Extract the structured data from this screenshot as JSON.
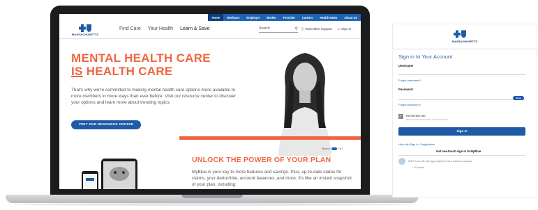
{
  "laptop": {
    "topbar": {
      "links": [
        {
          "label": "Home"
        },
        {
          "label": "Medicare"
        },
        {
          "label": "Employer"
        },
        {
          "label": "Broker"
        },
        {
          "label": "Provider"
        },
        {
          "label": "Careers"
        },
        {
          "label": "Health News"
        },
        {
          "label": "About Us"
        }
      ]
    },
    "nav": {
      "logo_text": "MASSACHUSETTS",
      "items": [
        "Find Care",
        "Your Health",
        "Learn & Save"
      ],
      "search_placeholder": "Search",
      "support_label": "Team Blue Support",
      "signin_label": "Sign In"
    },
    "hero": {
      "title_line1": "MENTAL HEALTH CARE",
      "title_is": "IS",
      "title_line2_rest": " HEALTH CARE",
      "body": "That's why we're committed to making mental health care options more available to more members in more ways than ever before. Visit our resource center to discover your options and learn more about trending topics.",
      "cta": "VISIT OUR RESOURCE CENTER"
    },
    "motion": {
      "label": "Motion",
      "state": "On"
    },
    "unlock": {
      "title": "UNLOCK THE POWER OF YOUR PLAN",
      "body": "MyBlue is your key to more features and savings. Plus, up-to-date status for claims, your deductible, account balances, and more. It's like an instant snapshot of your plan, including:"
    },
    "colors": {
      "accent": "#f0653f",
      "brand": "#1e5aa5",
      "topbar": "#1e63b3"
    }
  },
  "signin": {
    "logo_text": "MASSACHUSETTS",
    "heading": "Sign in to Your Account",
    "username_label": "Username",
    "forgot_username": "Forgot username?",
    "password_label": "Password",
    "show_label": "Show",
    "forgot_password": "Forgot password?",
    "remember_label": "Remember Me",
    "remember_sub": "(Not recommended if using a shared device.)",
    "signin_button": "Sign In",
    "help_link": "Help with Sign In / Registration",
    "onetouch_label": "Get one-touch sign in to MyBlue",
    "touch_text": "With Touch ID, the app makes it even easier to access:",
    "bullet": "ID cards"
  }
}
